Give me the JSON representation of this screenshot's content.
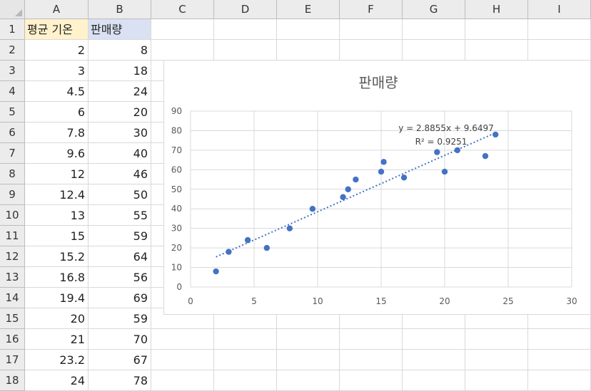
{
  "columns": [
    "A",
    "B",
    "C",
    "D",
    "E",
    "F",
    "G",
    "H",
    "I"
  ],
  "rows": [
    "1",
    "2",
    "3",
    "4",
    "5",
    "6",
    "7",
    "8",
    "9",
    "10",
    "11",
    "12",
    "13",
    "14",
    "15",
    "16",
    "17",
    "18"
  ],
  "headers": {
    "a1": "평균 기온",
    "b1": "판매량"
  },
  "table": {
    "temp": [
      "2",
      "3",
      "4.5",
      "6",
      "7.8",
      "9.6",
      "12",
      "12.4",
      "13",
      "15",
      "15.2",
      "16.8",
      "19.4",
      "20",
      "21",
      "23.2",
      "24"
    ],
    "sales": [
      "8",
      "18",
      "24",
      "20",
      "30",
      "40",
      "46",
      "50",
      "55",
      "59",
      "64",
      "56",
      "69",
      "59",
      "70",
      "67",
      "78"
    ]
  },
  "chart_data": {
    "type": "scatter",
    "title": "판매량",
    "x": [
      2,
      3,
      4.5,
      6,
      7.8,
      9.6,
      12,
      12.4,
      13,
      15,
      15.2,
      16.8,
      19.4,
      20,
      21,
      23.2,
      24
    ],
    "y": [
      8,
      18,
      24,
      20,
      30,
      40,
      46,
      50,
      55,
      59,
      64,
      56,
      69,
      59,
      70,
      67,
      78
    ],
    "xlim": [
      0,
      30
    ],
    "ylim": [
      0,
      90
    ],
    "x_ticks": [
      "0",
      "5",
      "10",
      "15",
      "20",
      "25",
      "30"
    ],
    "y_ticks": [
      "0",
      "10",
      "20",
      "30",
      "40",
      "50",
      "60",
      "70",
      "80",
      "90"
    ],
    "trendline": {
      "slope": 2.8855,
      "intercept": 9.6497,
      "equation": "y = 2.8855x + 9.6497",
      "r2": "R² = 0.9251"
    },
    "marker_color": "#4472c4",
    "trend_color": "#4472c4",
    "grid": true,
    "legend": "none"
  }
}
